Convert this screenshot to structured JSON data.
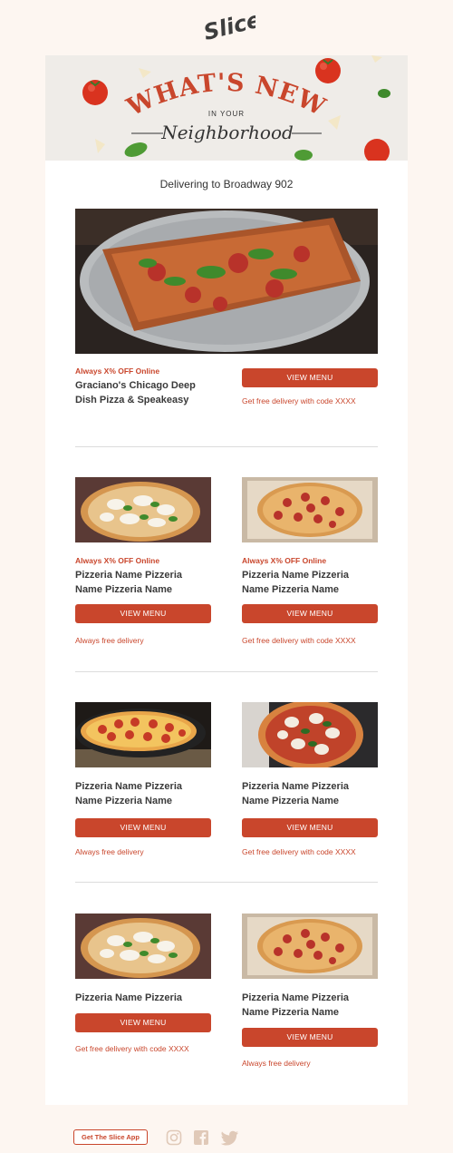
{
  "brand": {
    "logo_text": "Slice"
  },
  "hero": {
    "title": "WHAT'S NEW",
    "subtitle": "IN YOUR",
    "script": "Neighborhood"
  },
  "delivering": "Delivering to Broadway 902",
  "featured": {
    "offer": "Always X% OFF Online",
    "name": "Graciano's Chicago Deep Dish Pizza & Speakeasy",
    "button": "VIEW MENU",
    "note": "Get free delivery with code XXXX"
  },
  "rows": [
    [
      {
        "offer": "Always X% OFF Online",
        "name": "Pizzeria Name Pizzeria Name Pizzeria Name",
        "button": "VIEW MENU",
        "note": "Always free delivery"
      },
      {
        "offer": "Always X% OFF Online",
        "name": "Pizzeria Name Pizzeria Name Pizzeria Name",
        "button": "VIEW MENU",
        "note": "Get free delivery with code XXXX"
      }
    ],
    [
      {
        "name": "Pizzeria Name Pizzeria Name Pizzeria Name",
        "button": "VIEW MENU",
        "note": "Always free delivery"
      },
      {
        "name": "Pizzeria Name Pizzeria Name Pizzeria Name",
        "button": "VIEW MENU",
        "note": "Get free delivery with code XXXX"
      }
    ],
    [
      {
        "name": "Pizzeria Name Pizzeria",
        "button": "VIEW MENU",
        "note": "Get free delivery with code XXXX"
      },
      {
        "name": "Pizzeria Name Pizzeria Name Pizzeria Name",
        "button": "VIEW MENU",
        "note": "Always free delivery"
      }
    ]
  ],
  "footer": {
    "app_button": "Get The Slice App",
    "social": [
      "instagram-icon",
      "facebook-icon",
      "twitter-icon"
    ]
  },
  "colors": {
    "accent": "#c9462c",
    "background": "#fdf6f1",
    "card": "#ffffff"
  }
}
